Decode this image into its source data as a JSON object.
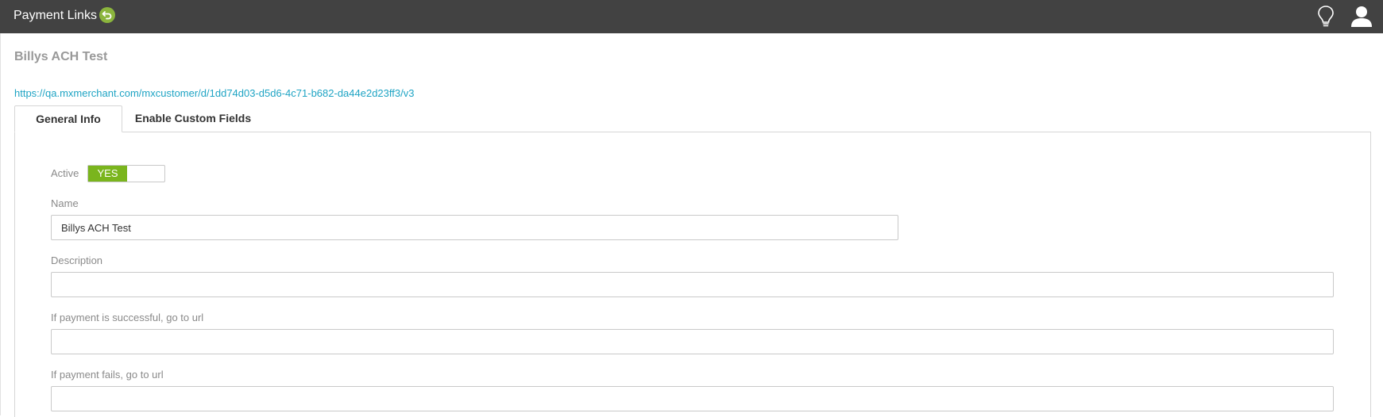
{
  "header": {
    "title": "Payment Links",
    "back_icon": "undo-icon",
    "hint_icon": "lightbulb-icon",
    "user_icon": "user-icon",
    "bar_color": "#424242",
    "accent_color": "#8bb53d"
  },
  "record": {
    "title": "Billys ACH Test",
    "url": "https://qa.mxmerchant.com/mxcustomer/d/1dd74d03-d5d6-4c71-b682-da44e2d23ff3/v3"
  },
  "tabs": [
    {
      "label": "General Info",
      "active": true
    },
    {
      "label": "Enable Custom Fields",
      "active": false
    }
  ],
  "form": {
    "active_label": "Active",
    "active_toggle": "YES",
    "toggle_color": "#7ab51d",
    "name_label": "Name",
    "name_value": "Billys ACH Test",
    "description_label": "Description",
    "description_value": "",
    "success_url_label": "If payment is successful, go to url",
    "success_url_value": "",
    "fail_url_label": "If payment fails, go to url",
    "fail_url_value": ""
  }
}
